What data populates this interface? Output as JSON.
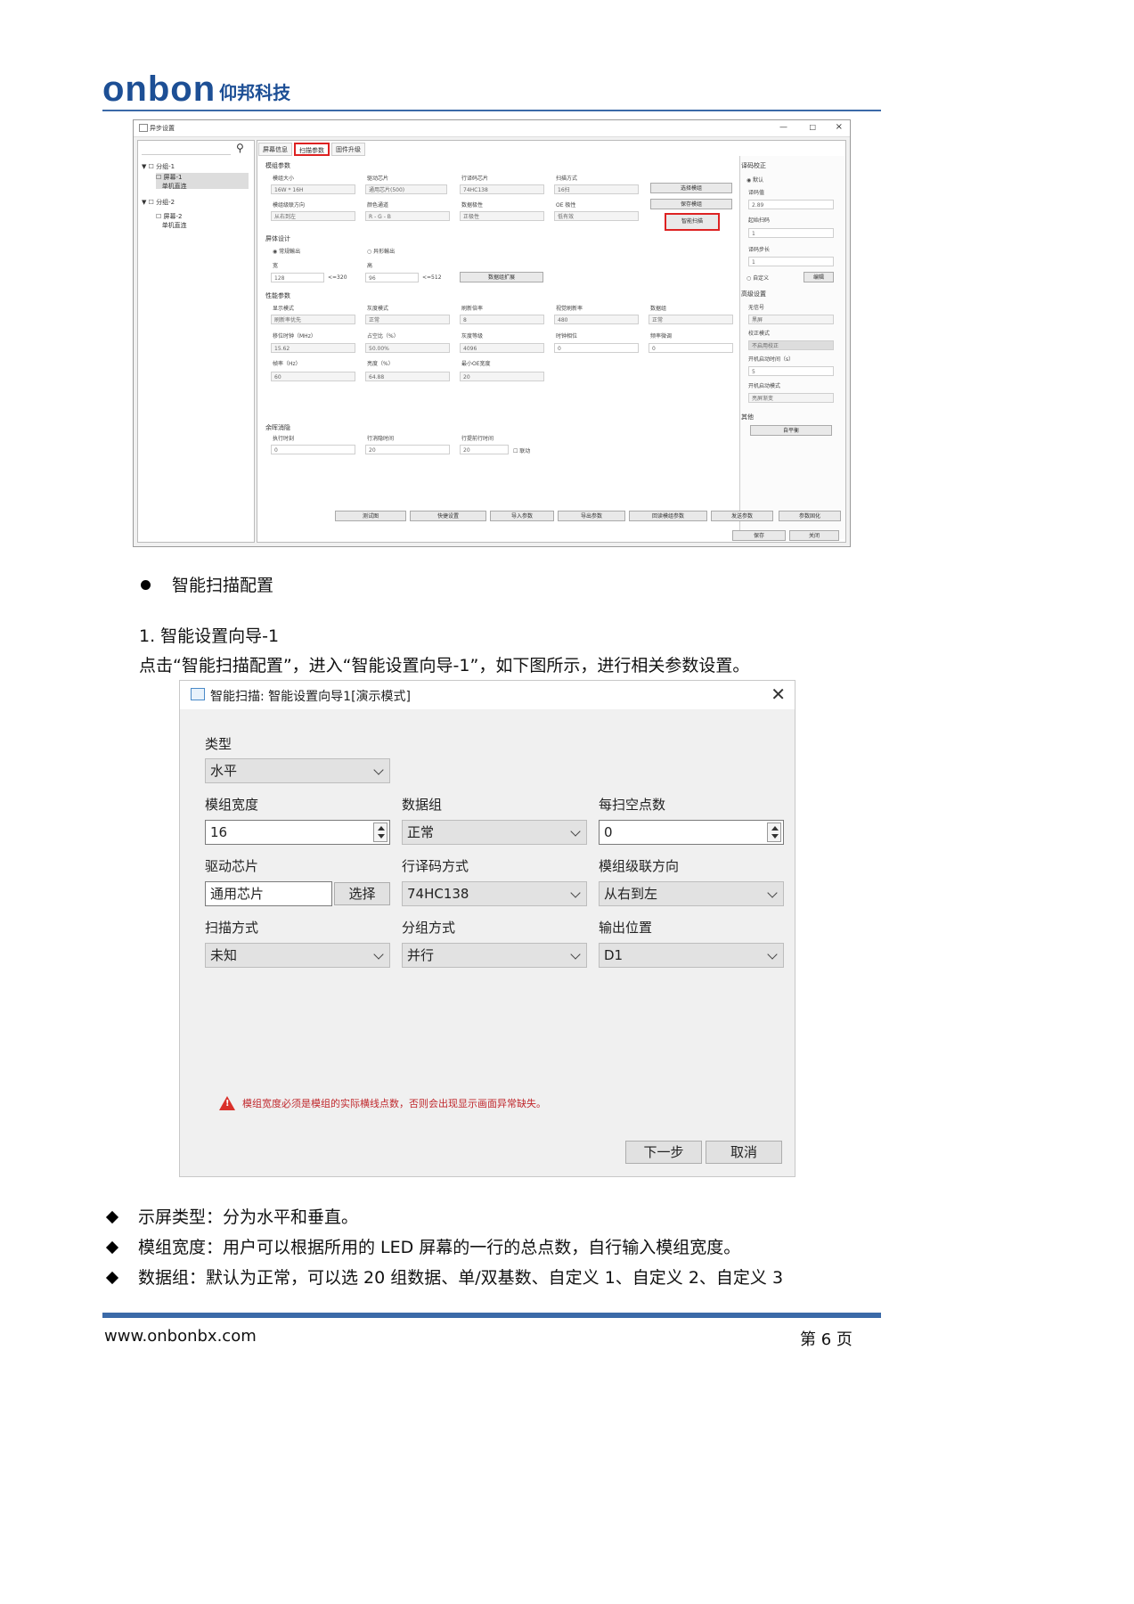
{
  "header": {
    "logo_en": "onbon",
    "logo_cn": "仰邦科技"
  },
  "small_window": {
    "title": "异步设置",
    "tree": [
      {
        "label": "分组-1"
      },
      {
        "label": "屏幕-1",
        "sub": "单机直连"
      },
      {
        "label": "分组-2"
      },
      {
        "label": "屏幕-2",
        "sub": "单机直连"
      }
    ],
    "tabs": [
      "屏幕信息",
      "扫描参数",
      "固件升级"
    ],
    "sections": {
      "module": "模组参数",
      "screen": "屏体设计",
      "performance": "性能参数",
      "blanking": "余晖消隐",
      "decode": "译码校正",
      "advanced": "高级设置",
      "other": "其他"
    },
    "module_fields": [
      {
        "label": "模组大小",
        "value": "16W * 16H"
      },
      {
        "label": "驱动芯片",
        "value": "通用芯片(500)"
      },
      {
        "label": "行译码芯片",
        "value": "74HC138"
      },
      {
        "label": "扫描方式",
        "value": "16扫"
      },
      {
        "label": "模组级联方向",
        "value": "从右到左"
      },
      {
        "label": "颜色通道",
        "value": "R - G - B"
      },
      {
        "label": "数据极性",
        "value": "正极性"
      },
      {
        "label": "OE 极性",
        "value": "低有效"
      }
    ],
    "module_buttons": [
      "选择模组",
      "保存模组",
      "智能扫描"
    ],
    "screen": {
      "radio1": "常规輸出",
      "radio2": "异形輸出",
      "width_label": "宽",
      "width": "128",
      "width_max": "<=320",
      "height_label": "高",
      "height": "96",
      "height_max": "<=512",
      "expand": "数据组扩展"
    },
    "perf_fields": [
      {
        "label": "显示模式",
        "value": "刷新率优先"
      },
      {
        "label": "灰度模式",
        "value": "正常"
      },
      {
        "label": "刷新倍率",
        "value": "8"
      },
      {
        "label": "视觉刷新率",
        "value": "480"
      },
      {
        "label": "数据组",
        "value": "正常"
      },
      {
        "label": "移位时钟（MHz）",
        "value": "15.62"
      },
      {
        "label": "占空比（%）",
        "value": "50.00%"
      },
      {
        "label": "灰度等级",
        "value": "4096"
      },
      {
        "label": "时钟相位",
        "value": "0"
      },
      {
        "label": "频率微调",
        "value": "0"
      },
      {
        "label": "帧率（Hz）",
        "value": "60"
      },
      {
        "label": "亮度（%）",
        "value": "64.88"
      },
      {
        "label": "最小OE宽度",
        "value": "20"
      }
    ],
    "blanking_fields": [
      {
        "label": "执行时刻",
        "value": "0"
      },
      {
        "label": "行消隐时间",
        "value": "20"
      },
      {
        "label": "行提前行时间",
        "value": "20"
      }
    ],
    "blanking_link": "联动",
    "decode": {
      "default": "默认",
      "code_label": "译码值",
      "code": "2.89",
      "start_label": "起始扫码",
      "start": "1",
      "step_label": "译码步长",
      "step": "1",
      "custom": "自定义",
      "edit": "编辑"
    },
    "advanced": [
      {
        "label": "无信号",
        "value": "黑屏"
      },
      {
        "label": "校正模式",
        "value": "不启用校正"
      },
      {
        "label": "开机启动时间（s）",
        "value": "5"
      },
      {
        "label": "开机启动模式",
        "value": "亮屏渐变"
      }
    ],
    "other_button": "自平衡",
    "bottom_buttons": [
      "测试图",
      "快捷设置",
      "导入参数",
      "导出参数",
      "回读模组参数",
      "发送参数",
      "参数固化"
    ],
    "final_buttons": [
      "保存",
      "关闭"
    ]
  },
  "body": {
    "bullet_title": "智能扫描配置",
    "numbered": "1.   智能设置向导-1",
    "paragraph": "点击“智能扫描配置”，进入“智能设置向导-1”，如下图所示，进行相关参数设置。"
  },
  "dialog": {
    "title": "智能扫描: 智能设置向导1[演示模式]",
    "type_label": "类型",
    "type_value": "水平",
    "width_label": "模组宽度",
    "width_value": "16",
    "data_group_label": "数据组",
    "data_group_value": "正常",
    "blank_label": "每扫空点数",
    "blank_value": "0",
    "chip_label": "驱动芯片",
    "chip_value": "通用芯片",
    "chip_select": "选择",
    "decode_label": "行译码方式",
    "decode_value": "74HC138",
    "cascade_label": "模组级联方向",
    "cascade_value": "从右到左",
    "scan_label": "扫描方式",
    "scan_value": "未知",
    "group_label": "分组方式",
    "group_value": "并行",
    "output_label": "输出位置",
    "output_value": "D1",
    "warning": "模组宽度必须是模组的实际横线点数，否则会出现显示画面异常缺失。",
    "next": "下一步",
    "cancel": "取消"
  },
  "list": [
    "示屏类型：分为水平和垂直。",
    "模组宽度：用户可以根据所用的 LED 屏幕的一行的总点数，自行输入模组宽度。",
    "数据组：默认为正常，可以选 20 组数据、单/双基数、自定义 1、自定义 2、自定义 3"
  ],
  "footer": {
    "url": "www.onbonbx.com",
    "page": "第 6 页"
  }
}
